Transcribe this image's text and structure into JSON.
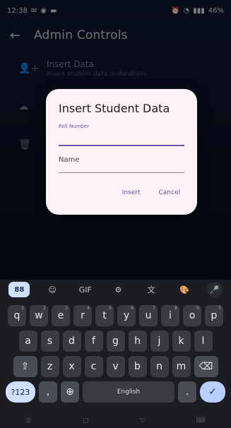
{
  "status_bar": {
    "time": "12:38",
    "left_icons": [
      "mail-icon",
      "camera-icon",
      "message-icon"
    ],
    "right_icons": [
      "alarm-icon",
      "wifi-icon",
      "signal-icon",
      "battery-icon"
    ],
    "battery": "46%"
  },
  "app_bar": {
    "back_glyph": "←",
    "title": "Admin Controls"
  },
  "list": {
    "items": [
      {
        "icon": "add-user-icon",
        "title": "Insert Data",
        "subtitle": "Insert student data in database"
      },
      {
        "icon": "cloud-upload-icon",
        "title": "",
        "subtitle": ""
      },
      {
        "icon": "delete-icon",
        "title": "",
        "subtitle": ""
      }
    ]
  },
  "dialog": {
    "title": "Insert Student Data",
    "roll_label": "Roll Number",
    "name_placeholder": "Name",
    "insert_label": "Insert",
    "cancel_label": "Cancel",
    "accent": "#6650a4",
    "background": "#fff2f6"
  },
  "keyboard": {
    "toolbar": [
      "88",
      "☺",
      "GIF",
      "⚙",
      "文",
      "🎨",
      "🎤"
    ],
    "row1": [
      {
        "k": "q",
        "n": "1"
      },
      {
        "k": "w",
        "n": "2"
      },
      {
        "k": "e",
        "n": "3"
      },
      {
        "k": "r",
        "n": "4"
      },
      {
        "k": "t",
        "n": "5"
      },
      {
        "k": "y",
        "n": "6"
      },
      {
        "k": "u",
        "n": "7"
      },
      {
        "k": "i",
        "n": "8"
      },
      {
        "k": "o",
        "n": "9"
      },
      {
        "k": "p",
        "n": "0"
      }
    ],
    "row2": [
      "a",
      "s",
      "d",
      "f",
      "g",
      "h",
      "j",
      "k",
      "l"
    ],
    "row3": [
      "z",
      "x",
      "c",
      "v",
      "b",
      "n",
      "m"
    ],
    "shift_glyph": "⇧",
    "backspace_glyph": "⌫",
    "num_label": "?123",
    "comma_glyph": ",",
    "globe_glyph": "⊕",
    "space_label": "English",
    "period_glyph": ".",
    "enter_glyph": "✓"
  },
  "nav": {
    "items": [
      "☰",
      "▢",
      "▽",
      "⌨"
    ]
  }
}
